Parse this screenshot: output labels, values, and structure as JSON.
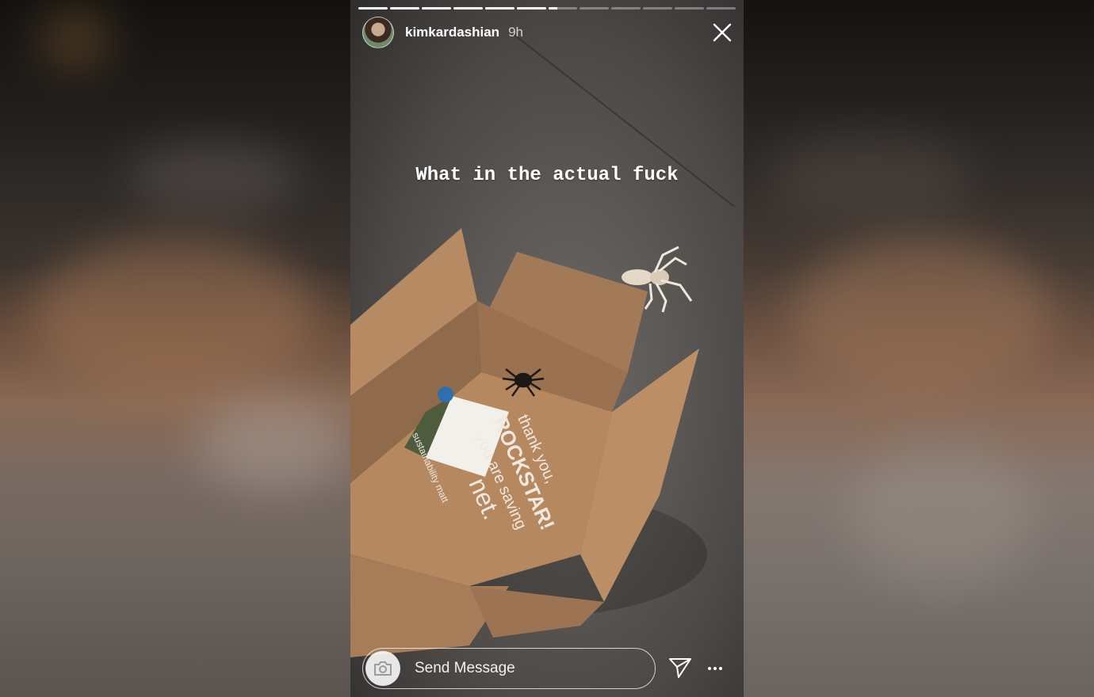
{
  "story": {
    "username": "kimkardashian",
    "time_ago": "9h",
    "caption": "What in the actual fuck",
    "progress": {
      "segments": 12,
      "completed": 6,
      "current_fill": 0.3
    }
  },
  "box_print": {
    "line1": "thank you,",
    "line2": "ROCKSTAR!",
    "line3": "you are saving",
    "line4": "net.",
    "brand": "sustainability matt"
  },
  "composer": {
    "placeholder": "Send Message"
  },
  "icons": {
    "close": "close-icon",
    "camera": "camera-icon",
    "send": "send-icon",
    "more": "more-icon"
  },
  "colors": {
    "text": "#ffffff",
    "cardboard": "#b08460"
  }
}
